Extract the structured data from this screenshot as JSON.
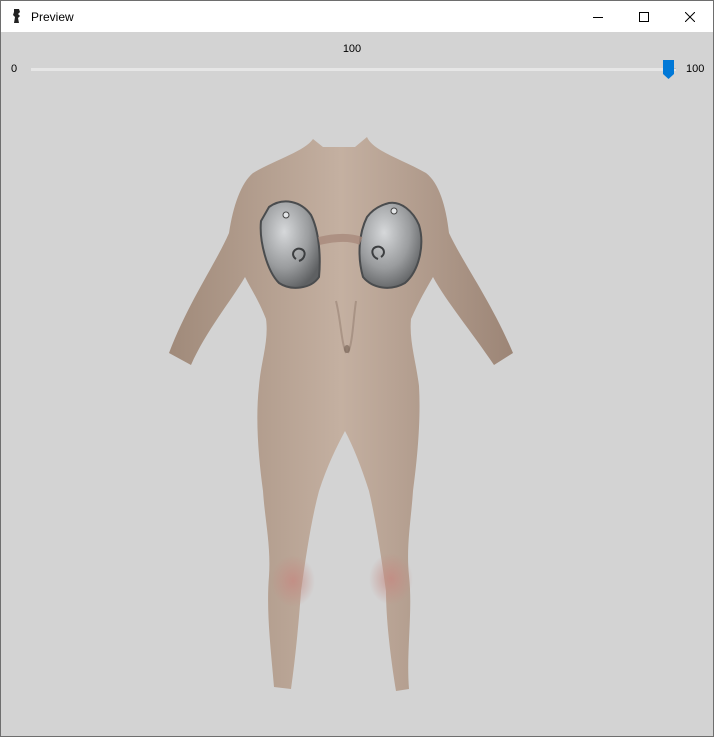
{
  "window": {
    "title": "Preview",
    "app_icon": "figure-silhouette-icon",
    "controls": {
      "minimize_icon": "minimize-icon",
      "maximize_icon": "maximize-icon",
      "close_icon": "close-icon"
    }
  },
  "slider": {
    "value_label": "100",
    "min_label": "0",
    "max_label": "100",
    "value": 100,
    "min": 0,
    "max": 100,
    "accent_color": "#0078d7"
  },
  "preview": {
    "background_color": "#d3d3d3",
    "skin_color": "#b9a596",
    "armor_color": "#9a9c9e"
  }
}
